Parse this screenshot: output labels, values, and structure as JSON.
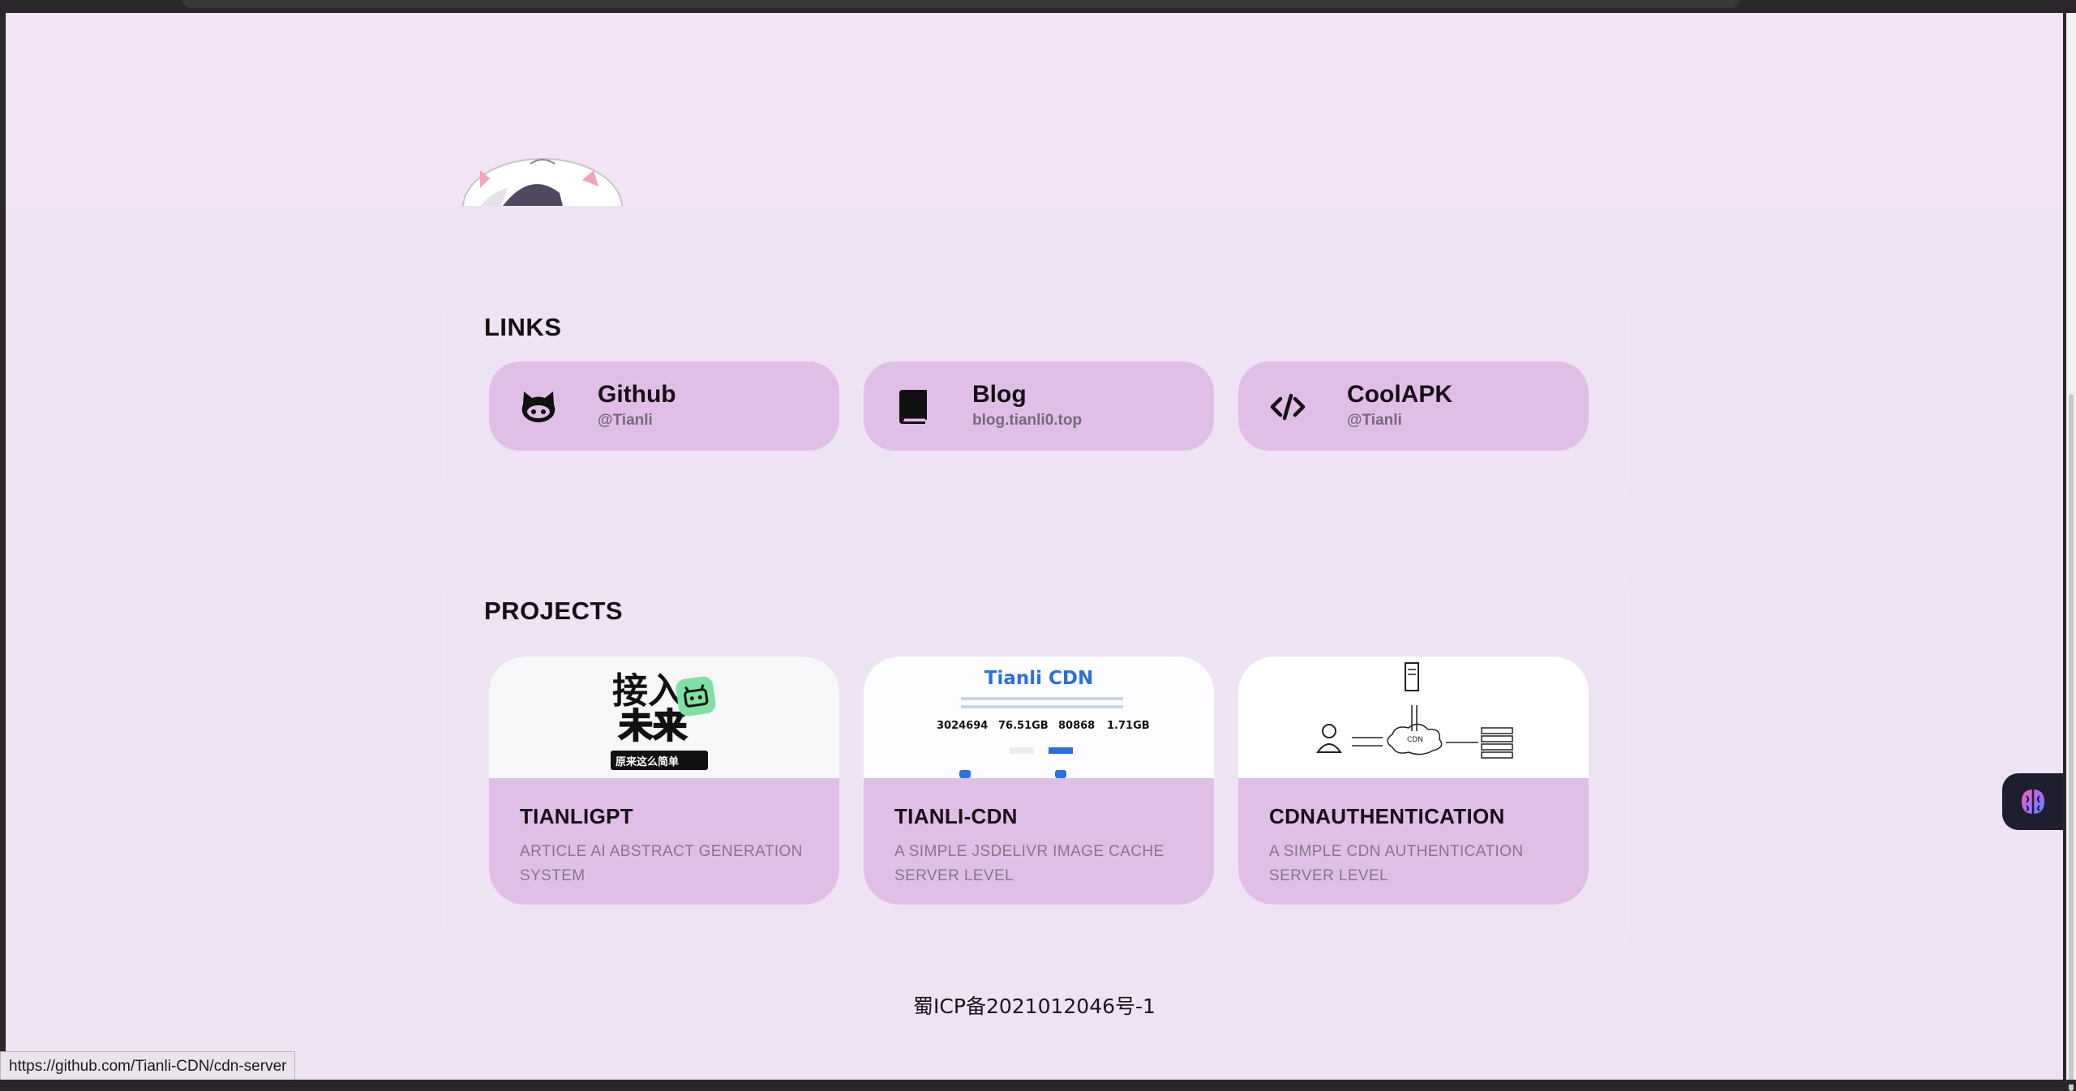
{
  "links": {
    "title": "LINKS",
    "items": [
      {
        "title": "Github",
        "subtitle": "@Tianli",
        "icon": "github-icon"
      },
      {
        "title": "Blog",
        "subtitle": "blog.tianli0.top",
        "icon": "book-icon"
      },
      {
        "title": "CoolAPK",
        "subtitle": "@Tianli",
        "icon": "code-icon"
      }
    ]
  },
  "projects": {
    "title": "PROJECTS",
    "items": [
      {
        "title": "TIANLIGPT",
        "description": "ARTICLE AI ABSTRACT GENERATION SYSTEM",
        "thumb": {
          "line1": "接入",
          "line2": "未来",
          "caption": "原来这么简单"
        }
      },
      {
        "title": "TIANLI-CDN",
        "description": "A SIMPLE JSDELIVR IMAGE CACHE SERVER LEVEL",
        "thumb": {
          "heading": "Tianli CDN",
          "stats": [
            "3024694",
            "76.51GB",
            "80868",
            "1.71GB"
          ]
        }
      },
      {
        "title": "CDNAUTHENTICATION",
        "description": "A SIMPLE CDN AUTHENTICATION SERVER LEVEL",
        "thumb": {
          "cloud_label": "CDN"
        }
      }
    ]
  },
  "footer": {
    "icp": "蜀ICP备2021012046号-1"
  },
  "status_bar": {
    "url": "https://github.com/Tianli-CDN/cdn-server"
  },
  "colors": {
    "page_bg": "#efe2f3",
    "card_bg": "#e0bfe6",
    "text": "#150f15",
    "muted": "#76687a"
  }
}
